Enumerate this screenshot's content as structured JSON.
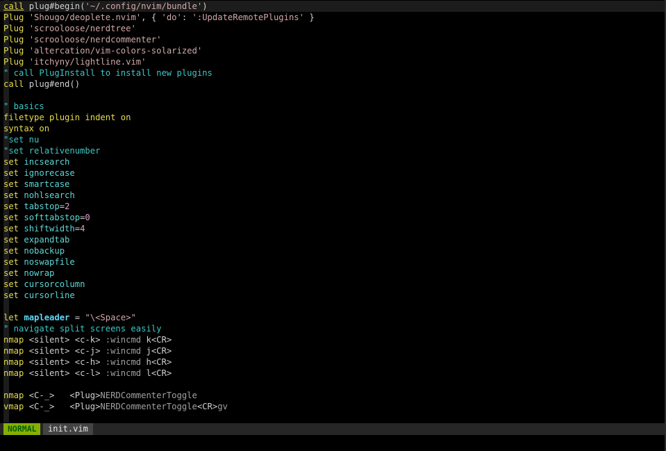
{
  "editor": {
    "lines": [
      [
        {
          "t": "call",
          "c": "kw"
        },
        {
          "t": " plug#begin(",
          "c": "plain"
        },
        {
          "t": "'~/.config/nvim/bundle'",
          "c": "str"
        },
        {
          "t": ")",
          "c": "plain"
        }
      ],
      [
        {
          "t": "Plug",
          "c": "kw"
        },
        {
          "t": " ",
          "c": "plain"
        },
        {
          "t": "'Shougo/deoplete.nvim'",
          "c": "str"
        },
        {
          "t": ", { ",
          "c": "plain"
        },
        {
          "t": "'do'",
          "c": "str"
        },
        {
          "t": ": ",
          "c": "plain"
        },
        {
          "t": "':UpdateRemotePlugins'",
          "c": "str"
        },
        {
          "t": " }",
          "c": "plain"
        }
      ],
      [
        {
          "t": "Plug",
          "c": "kw"
        },
        {
          "t": " ",
          "c": "plain"
        },
        {
          "t": "'scrooloose/nerdtree'",
          "c": "str"
        }
      ],
      [
        {
          "t": "Plug",
          "c": "kw"
        },
        {
          "t": " ",
          "c": "plain"
        },
        {
          "t": "'scrooloose/nerdcommenter'",
          "c": "str"
        }
      ],
      [
        {
          "t": "Plug",
          "c": "kw"
        },
        {
          "t": " ",
          "c": "plain"
        },
        {
          "t": "'altercation/vim-colors-solarized'",
          "c": "str"
        }
      ],
      [
        {
          "t": "Plug",
          "c": "kw"
        },
        {
          "t": " ",
          "c": "plain"
        },
        {
          "t": "'itchyny/lightline.vim'",
          "c": "str"
        }
      ],
      [
        {
          "t": "\" call PlugInstall to install new plugins",
          "c": "com"
        }
      ],
      [
        {
          "t": "call",
          "c": "kw"
        },
        {
          "t": " plug#end()",
          "c": "plain"
        }
      ],
      [],
      [
        {
          "t": "\" basics",
          "c": "com"
        }
      ],
      [
        {
          "t": "filetype",
          "c": "kw"
        },
        {
          "t": " plugin indent on",
          "c": "kw"
        }
      ],
      [
        {
          "t": "syntax",
          "c": "kw"
        },
        {
          "t": " on",
          "c": "kw"
        }
      ],
      [
        {
          "t": "\"set nu",
          "c": "com"
        }
      ],
      [
        {
          "t": "\"set relativenumber",
          "c": "com"
        }
      ],
      [
        {
          "t": "set",
          "c": "kw"
        },
        {
          "t": " incsearch",
          "c": "opt"
        }
      ],
      [
        {
          "t": "set",
          "c": "kw"
        },
        {
          "t": " ignorecase",
          "c": "opt"
        }
      ],
      [
        {
          "t": "set",
          "c": "kw"
        },
        {
          "t": " smartcase",
          "c": "opt"
        }
      ],
      [
        {
          "t": "set",
          "c": "kw"
        },
        {
          "t": " nohlsearch",
          "c": "opt"
        }
      ],
      [
        {
          "t": "set",
          "c": "kw"
        },
        {
          "t": " tabstop",
          "c": "opt"
        },
        {
          "t": "=",
          "c": "plain"
        },
        {
          "t": "2",
          "c": "num"
        }
      ],
      [
        {
          "t": "set",
          "c": "kw"
        },
        {
          "t": " softtabstop",
          "c": "opt"
        },
        {
          "t": "=",
          "c": "plain"
        },
        {
          "t": "0",
          "c": "num"
        }
      ],
      [
        {
          "t": "set",
          "c": "kw"
        },
        {
          "t": " shiftwidth",
          "c": "opt"
        },
        {
          "t": "=",
          "c": "plain"
        },
        {
          "t": "4",
          "c": "num"
        }
      ],
      [
        {
          "t": "set",
          "c": "kw"
        },
        {
          "t": " expandtab",
          "c": "opt"
        }
      ],
      [
        {
          "t": "set",
          "c": "kw"
        },
        {
          "t": " nobackup",
          "c": "opt"
        }
      ],
      [
        {
          "t": "set",
          "c": "kw"
        },
        {
          "t": " noswapfile",
          "c": "opt"
        }
      ],
      [
        {
          "t": "set",
          "c": "kw"
        },
        {
          "t": " nowrap",
          "c": "opt"
        }
      ],
      [
        {
          "t": "set",
          "c": "kw"
        },
        {
          "t": " cursorcolumn",
          "c": "opt"
        }
      ],
      [
        {
          "t": "set",
          "c": "kw"
        },
        {
          "t": " cursorline",
          "c": "opt"
        }
      ],
      [],
      [
        {
          "t": "let",
          "c": "kw"
        },
        {
          "t": " ",
          "c": "plain"
        },
        {
          "t": "mapleader",
          "c": "var"
        },
        {
          "t": " = ",
          "c": "plain"
        },
        {
          "t": "\"\\<Space>\"",
          "c": "str"
        }
      ],
      [
        {
          "t": "\" navigate split screens easily",
          "c": "com"
        }
      ],
      [
        {
          "t": "nmap",
          "c": "kw"
        },
        {
          "t": " <silent> <c-k> ",
          "c": "plain"
        },
        {
          "t": ":wincmd",
          "c": "dim"
        },
        {
          "t": " k<CR>",
          "c": "plain"
        }
      ],
      [
        {
          "t": "nmap",
          "c": "kw"
        },
        {
          "t": " <silent> <c-j> ",
          "c": "plain"
        },
        {
          "t": ":wincmd",
          "c": "dim"
        },
        {
          "t": " j<CR>",
          "c": "plain"
        }
      ],
      [
        {
          "t": "nmap",
          "c": "kw"
        },
        {
          "t": " <silent> <c-h> ",
          "c": "plain"
        },
        {
          "t": ":wincmd",
          "c": "dim"
        },
        {
          "t": " h<CR>",
          "c": "plain"
        }
      ],
      [
        {
          "t": "nmap",
          "c": "kw"
        },
        {
          "t": " <silent> <c-l> ",
          "c": "plain"
        },
        {
          "t": ":wincmd",
          "c": "dim"
        },
        {
          "t": " l<CR>",
          "c": "plain"
        }
      ],
      [],
      [
        {
          "t": "nmap",
          "c": "kw"
        },
        {
          "t": " <C-_>   <Plug>",
          "c": "plain"
        },
        {
          "t": "NERDCommenterToggle",
          "c": "dim"
        }
      ],
      [
        {
          "t": "vmap",
          "c": "kw"
        },
        {
          "t": " <C-_>   <Plug>",
          "c": "plain"
        },
        {
          "t": "NERDCommenterToggle",
          "c": "dim"
        },
        {
          "t": "<CR>",
          "c": "plain"
        },
        {
          "t": "gv",
          "c": "dim"
        }
      ]
    ]
  },
  "statusline": {
    "mode": "NORMAL",
    "filename": "init.vim"
  },
  "colors": {
    "background": "#000000",
    "keyword": "#e6db4f",
    "string": "#d2a8a8",
    "comment": "#3fc6c6",
    "mode_bg": "#87af00",
    "mode_fg": "#005f00"
  }
}
